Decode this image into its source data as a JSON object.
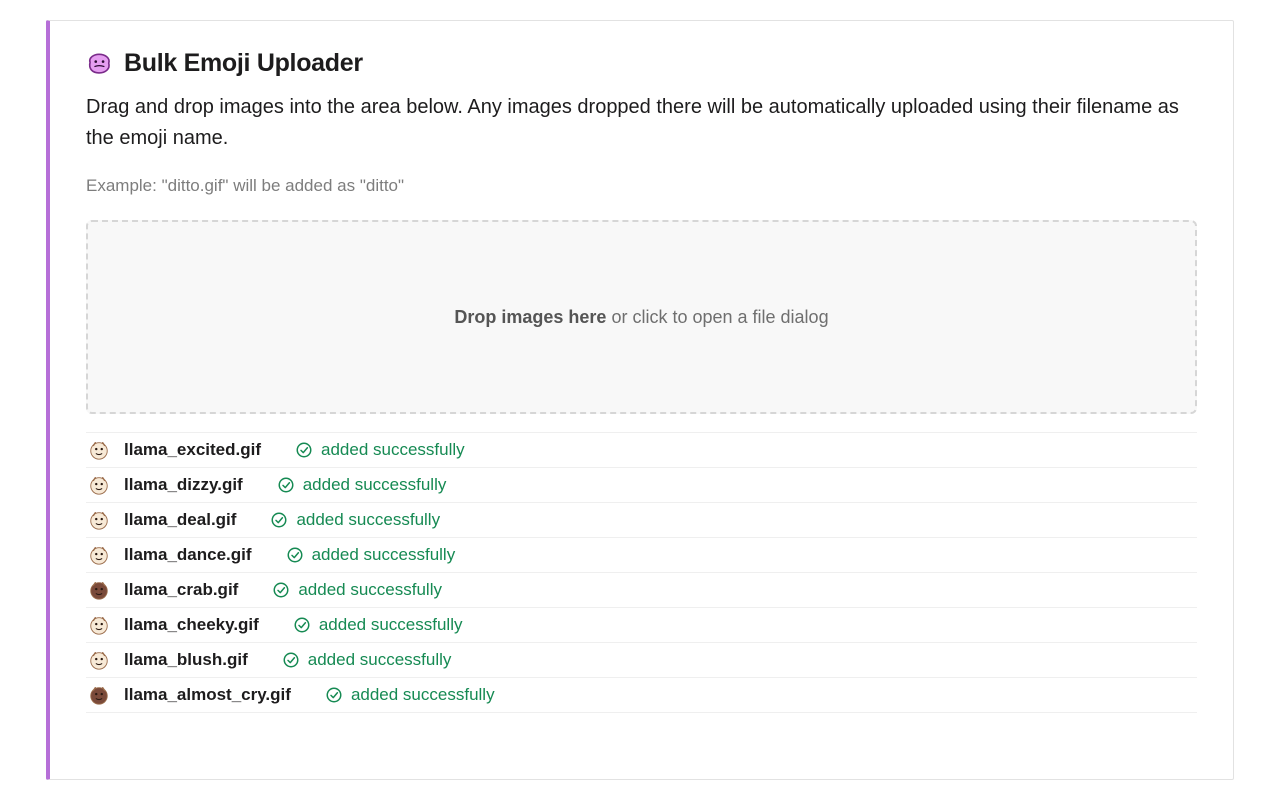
{
  "header": {
    "title": "Bulk Emoji Uploader",
    "description": "Drag and drop images into the area below. Any images dropped there will be automatically uploaded using their filename as the emoji name.",
    "example": "Example: \"ditto.gif\" will be added as \"ditto\""
  },
  "dropzone": {
    "bold": "Drop images here",
    "rest": " or click to open a file dialog"
  },
  "status_label": "added successfully",
  "uploads": [
    {
      "filename": "llama_excited.gif",
      "thumb": "light",
      "status": "success"
    },
    {
      "filename": "llama_dizzy.gif",
      "thumb": "light",
      "status": "success"
    },
    {
      "filename": "llama_deal.gif",
      "thumb": "light",
      "status": "success"
    },
    {
      "filename": "llama_dance.gif",
      "thumb": "light",
      "status": "success"
    },
    {
      "filename": "llama_crab.gif",
      "thumb": "dark",
      "status": "success"
    },
    {
      "filename": "llama_cheeky.gif",
      "thumb": "light",
      "status": "success"
    },
    {
      "filename": "llama_blush.gif",
      "thumb": "light",
      "status": "success"
    },
    {
      "filename": "llama_almost_cry.gif",
      "thumb": "dark",
      "status": "success"
    }
  ]
}
